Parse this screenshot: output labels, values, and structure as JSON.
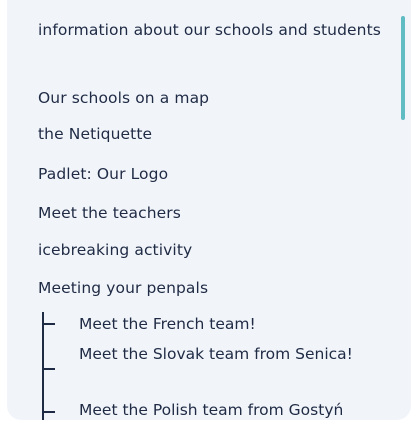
{
  "nav": {
    "items": [
      {
        "label": "information about our schools and students"
      },
      {
        "label": "Our schools on a map"
      },
      {
        "label": "the Netiquette"
      },
      {
        "label": "Padlet: Our Logo"
      },
      {
        "label": "Meet the teachers"
      },
      {
        "label": "icebreaking activity"
      },
      {
        "label": "Meeting your penpals"
      }
    ],
    "subitems": [
      {
        "label": "Meet the French team!"
      },
      {
        "label": "Meet the Slovak team from Senica!"
      },
      {
        "label": "Meet the Polish team from Gostyń"
      }
    ]
  },
  "colors": {
    "panel_bg": "#f1f5fa",
    "text": "#1f2a44",
    "scrollbar": "#5fbcc2"
  }
}
